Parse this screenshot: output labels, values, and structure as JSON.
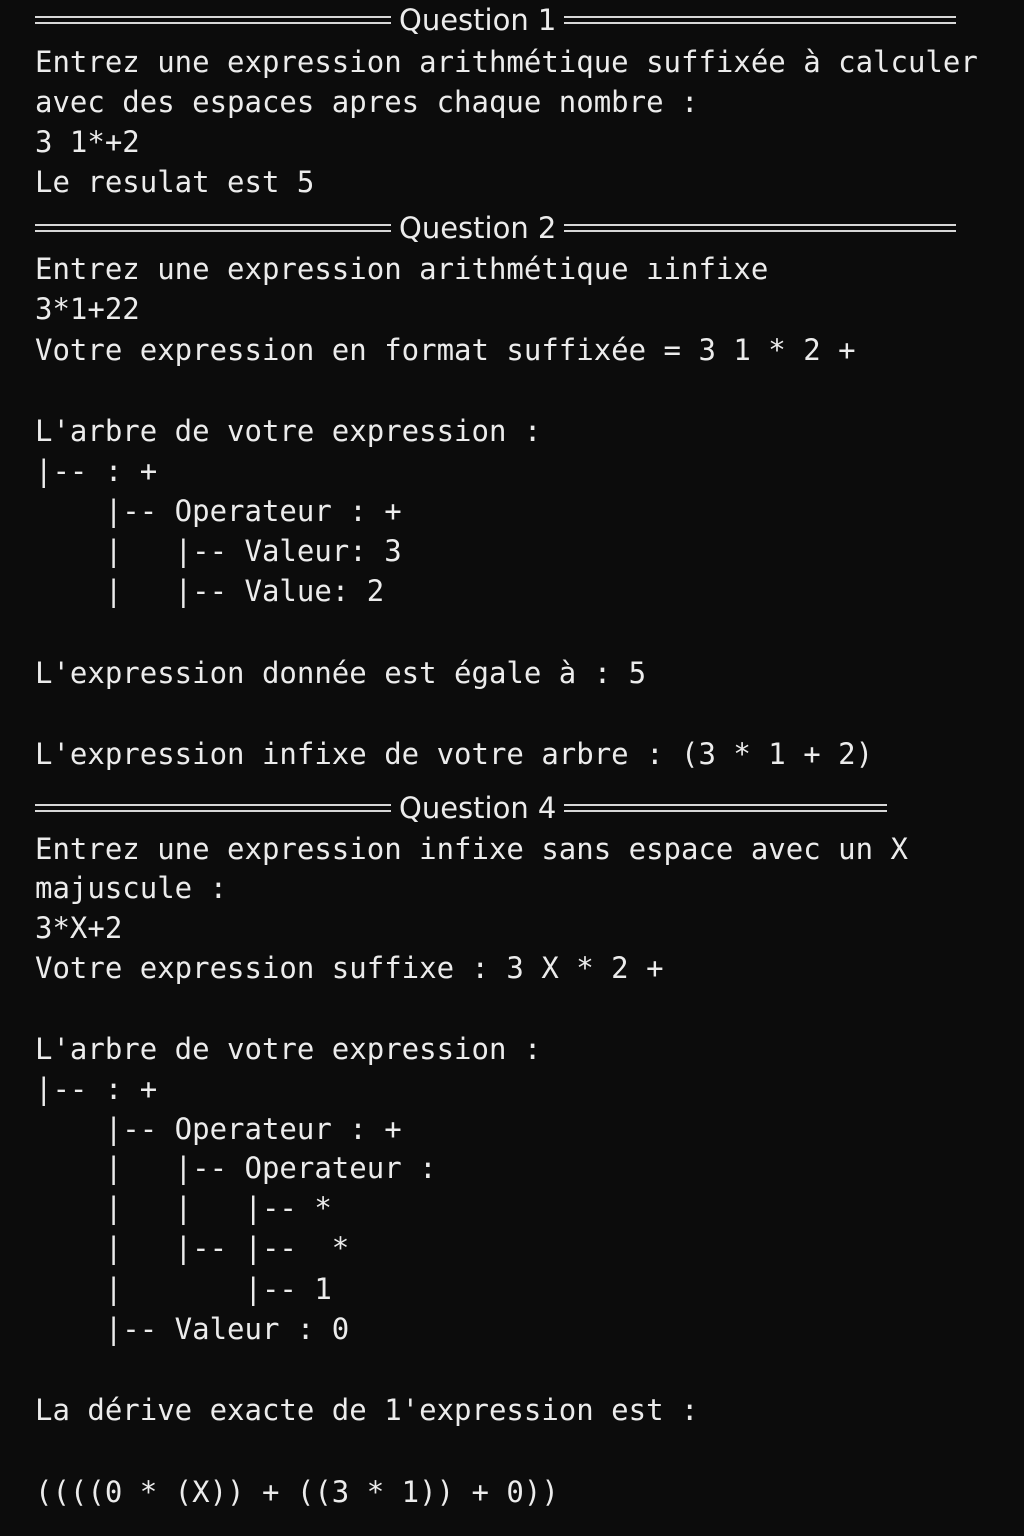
{
  "terminal": {
    "q1": {
      "title": "Question 1",
      "prompt_line1": "Entrez une expression arithmétique suffixée à calculer",
      "prompt_line2": "avec des espaces apres chaque nombre :",
      "input": "3 1*+2",
      "result": "Le resulat est 5"
    },
    "q2": {
      "title": "Question 2",
      "prompt": "Entrez une expression arithmétique ıinfixe",
      "input": "3*1+22",
      "postfix": "Votre expression en format suffixée = 3 1 * 2 +",
      "tree_title": "L'arbre de votre expression :",
      "tree": [
        "|-- : +",
        "    |-- Operateur : +",
        "    |   |-- Valeur: 3",
        "    |   |-- Value: 2"
      ],
      "value_line": "L'expression donnée est égale à : 5",
      "infix_line": "L'expression infixe de votre arbre : (3 * 1 + 2)"
    },
    "q4": {
      "title": "Question 4",
      "prompt_line1": "Entrez une expression infixe sans espace avec un X",
      "prompt_line2": "majuscule :",
      "input": "3*X+2",
      "postfix": "Votre expression suffixe : 3 X * 2 +",
      "tree_title": "L'arbre de votre expression :",
      "tree": [
        "|-- : +",
        "    |-- Operateur : +",
        "    |   |-- Operateur :",
        "    |   |   |-- *",
        "    |   |-- |--  *",
        "    |       |-- 1",
        "    |-- Valeur : 0"
      ],
      "derive_title": "La dérive exacte de 1'expression est :",
      "derive_value": "((((0 * (X)) + ((3 * 1)) + 0))"
    }
  }
}
